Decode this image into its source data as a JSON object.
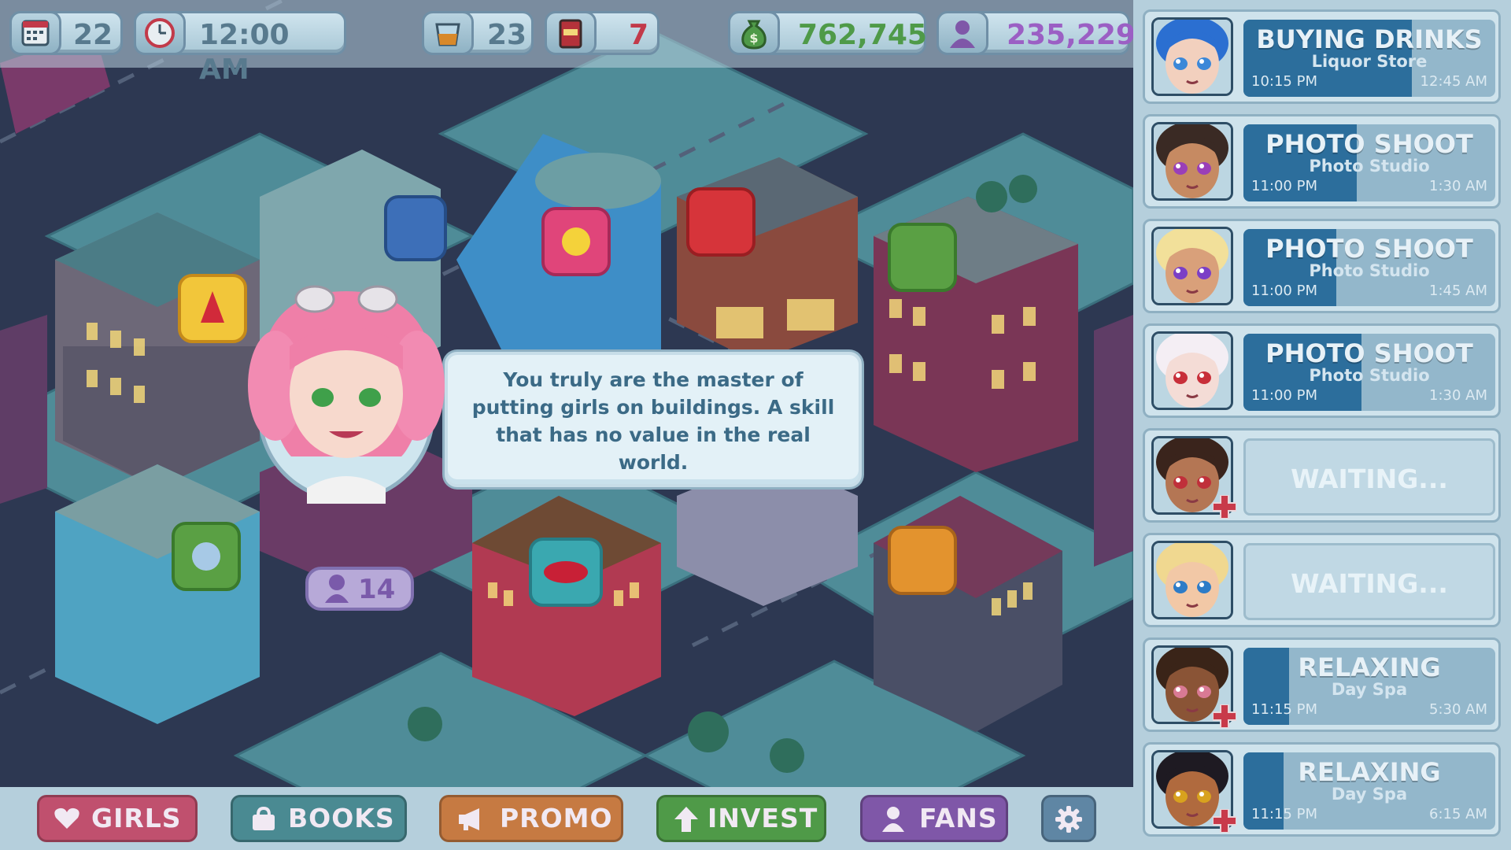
{
  "top_bar": {
    "day": "22",
    "clock": "12:00 AM",
    "drinks": "23",
    "books": "7",
    "money": "762,745",
    "fans": "235,229"
  },
  "dialogue": {
    "text": "You truly are the master of putting girls on buildings. A skill that has no value in the real world."
  },
  "map": {
    "building_badge_count": "14"
  },
  "bottom_nav": {
    "girls": "GIRLS",
    "books": "BOOKS",
    "promo": "PROMO",
    "invest": "INVEST",
    "fans": "FANS"
  },
  "colors": {
    "girls": "#c0506e",
    "books": "#4a8a92",
    "promo": "#c67a42",
    "invest": "#4f9a48",
    "fans": "#7f57a8",
    "settings": "#5f86a4",
    "task_fill": "#2c6e9c"
  },
  "girls": [
    {
      "hair": "#2b6fd1",
      "skin": "#f2d0be",
      "eyes": "#3c88d8",
      "status": "BUYING DRINKS",
      "location": "Liquor Store",
      "start": "10:15 PM",
      "end": "12:45 AM",
      "progress": 0.67,
      "injured": false
    },
    {
      "hair": "#3a2a24",
      "skin": "#c68a62",
      "eyes": "#9a3fb8",
      "status": "PHOTO SHOOT",
      "location": "Photo Studio",
      "start": "11:00 PM",
      "end": "1:30 AM",
      "progress": 0.45,
      "injured": false
    },
    {
      "hair": "#f2e09a",
      "skin": "#d9a07a",
      "eyes": "#7b3fc6",
      "status": "PHOTO SHOOT",
      "location": "Photo Studio",
      "start": "11:00 PM",
      "end": "1:45 AM",
      "progress": 0.37,
      "injured": false
    },
    {
      "hair": "#f4eef4",
      "skin": "#f4dcd6",
      "eyes": "#c82f3a",
      "status": "PHOTO SHOOT",
      "location": "Photo Studio",
      "start": "11:00 PM",
      "end": "1:30 AM",
      "progress": 0.47,
      "injured": false
    },
    {
      "hair": "#3a241c",
      "skin": "#b47654",
      "eyes": "#c0303a",
      "status": "WAITING...",
      "location": "",
      "start": "",
      "end": "",
      "progress": 0,
      "injured": true
    },
    {
      "hair": "#f0d890",
      "skin": "#f2c8a6",
      "eyes": "#2d7cc7",
      "status": "WAITING...",
      "location": "",
      "start": "",
      "end": "",
      "progress": 0,
      "injured": false
    },
    {
      "hair": "#3a2418",
      "skin": "#8a5436",
      "eyes": "#d97a94",
      "status": "RELAXING",
      "location": "Day Spa",
      "start": "11:15 PM",
      "end": "5:30 AM",
      "progress": 0.18,
      "injured": true
    },
    {
      "hair": "#1e1a22",
      "skin": "#b06a3e",
      "eyes": "#d8a21e",
      "status": "RELAXING",
      "location": "Day Spa",
      "start": "11:15 PM",
      "end": "6:15 AM",
      "progress": 0.16,
      "injured": true
    }
  ]
}
